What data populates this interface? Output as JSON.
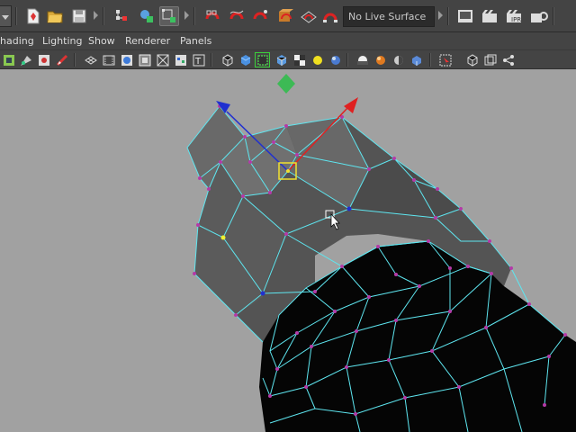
{
  "toolbar": {
    "live_surface_label": "No Live Surface",
    "icons": [
      "dropdown-arrow",
      "new-scene-icon",
      "open-scene-icon",
      "save-scene-icon",
      "select-hierarchy-icon",
      "select-object-icon",
      "select-component-icon",
      "snap-to-grid-icon",
      "snap-to-curve-icon",
      "snap-to-point-icon",
      "snap-to-projected-icon",
      "snap-to-view-plane-icon",
      "make-live-icon",
      "render-view-icon",
      "render-current-frame-icon",
      "ipr-render-icon",
      "render-settings-icon"
    ]
  },
  "menubar": {
    "items": [
      "hading",
      "Lighting",
      "Show",
      "Renderer",
      "Panels"
    ]
  },
  "panel_toolbar": {
    "icons": [
      "select-camera-icon",
      "camera-attributes-icon",
      "bookmarks-icon",
      "image-plane-icon",
      "grid-icon",
      "film-gate-icon",
      "resolution-gate-icon",
      "gate-mask-icon",
      "field-chart-icon",
      "safe-action-icon",
      "safe-title-icon",
      "wireframe-icon",
      "smooth-shade-icon",
      "wireframe-on-shaded-icon",
      "textured-icon",
      "use-all-lights-icon",
      "shadows-icon",
      "ambient-occlusion-icon",
      "motion-blur-icon",
      "multisample-icon",
      "depth-of-field-icon",
      "isolate-select-icon",
      "xray-icon",
      "xray-joints-icon",
      "xray-components-icon"
    ]
  },
  "colors": {
    "viewport_bg": "#a1a1a1",
    "wire": "#5ee6f0",
    "vertex": "#b43aa8",
    "selected_vertex": "#f0f030",
    "axis_x": "#e02020",
    "axis_z": "#2030d0",
    "axis_y": "#30c040"
  }
}
